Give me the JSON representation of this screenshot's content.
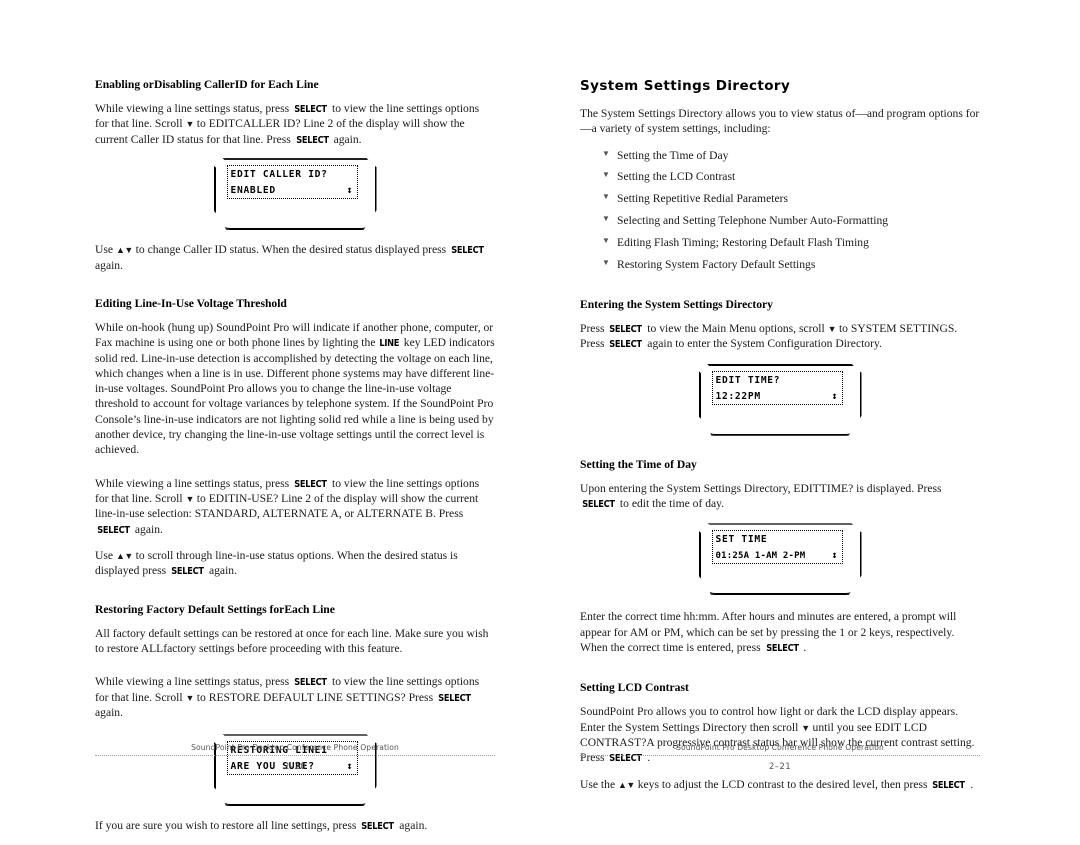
{
  "document": {
    "footer_title": "SoundPoint Pro Desktop Conference Phone Operation"
  },
  "left_page": {
    "page_number": "2–20",
    "sections": [
      {
        "heading": "Enabling orDisabling CallerID for Each Line",
        "para1_a": "While viewing a line settings status, press ",
        "para1_kb1": "SELECT",
        "para1_b": " to view the line settings options for that line. Scroll ",
        "para1_arrow": "▼",
        "para1_c": " to EDITCALLER ID? Line 2 of the display will show the current Caller ID status for that line. Press ",
        "para1_kb2": "SELECT",
        "para1_d": " again.",
        "lcd_line1": "EDIT CALLER ID?",
        "lcd_line2": "ENABLED",
        "lcd_updown": "↕",
        "para2_a": "Use ",
        "para2_arrows": "▲▼",
        "para2_b": " to change Caller ID status. When the desired status displayed press ",
        "para2_kb": "SELECT",
        "para2_c": " again."
      },
      {
        "heading": "Editing Line-In-Use Voltage Threshold",
        "para1_a": "While on-hook (hung up) SoundPoint Pro will indicate if another phone, computer, or Fax machine is using one or both phone lines by lighting the ",
        "para1_kb": "LINE",
        "para1_b": " key LED indicators solid red. Line-in-use detection is accomplished by detecting the voltage on each line, which changes when a line is in use. Different phone systems may have different line-in-use voltages. SoundPoint Pro allows you to change the line-in-use voltage threshold to account for voltage variances by telephone system. If the SoundPoint Pro Console’s line-in-use indicators are not lighting solid red while a line is being used by another device, try changing the line-in-use voltage settings until the correct level is achieved.",
        "para2_a": "While viewing a line settings status, press ",
        "para2_kb1": "SELECT",
        "para2_b": " to view the line settings options for that line. Scroll ",
        "para2_arrow": "▼",
        "para2_c": " to EDITIN-USE? Line 2 of the display will show the current line-in-use selection: STANDARD, ALTERNATE A, or ALTERNATE B. Press ",
        "para2_kb2": "SELECT",
        "para2_d": " again.",
        "para3_a": "Use ",
        "para3_arrows": "▲▼",
        "para3_b": " to scroll through line-in-use status options. When the desired status is displayed press ",
        "para3_kb": "SELECT",
        "para3_c": " again."
      },
      {
        "heading": "Restoring Factory Default Settings forEach Line",
        "para1": "All factory default settings can be restored at once for each line. Make sure you wish to restore ALLfactory settings before proceeding with this feature.",
        "para2_a": "While viewing a line settings status, press ",
        "para2_kb1": "SELECT",
        "para2_b": " to view the line settings options for that line. Scroll ",
        "para2_arrow": "▼",
        "para2_c": " to RESTORE DEFAULT LINE SETTINGS? Press ",
        "para2_kb2": "SELECT",
        "para2_d": " again.",
        "lcd_line1": "RESTORING LINE1",
        "lcd_line2": "ARE YOU SURE?",
        "lcd_updown": "↕",
        "para3_a": "If you are sure you wish to restore all line settings, press ",
        "para3_kb": "SELECT",
        "para3_b": " again."
      }
    ]
  },
  "right_page": {
    "page_number": "2–21",
    "title": "System Settings Directory",
    "intro": "The System Settings Directory allows you to view status of—and program options for—a variety of system settings, including:",
    "bullet_marker": "▼",
    "bullets": [
      "Setting the Time of Day",
      "Setting the LCD Contrast",
      "Setting Repetitive Redial Parameters",
      "Selecting and Setting Telephone Number Auto-Formatting",
      "Editing Flash Timing; Restoring Default Flash Timing",
      "Restoring System Factory Default Settings"
    ],
    "sections": [
      {
        "heading": "Entering the System Settings Directory",
        "para1_a": "Press ",
        "para1_kb1": "SELECT",
        "para1_b": " to view the Main Menu options, scroll ",
        "para1_arrow": "▼",
        "para1_c": " to SYSTEM SETTINGS. Press ",
        "para1_kb2": "SELECT",
        "para1_d": " again to enter the System Configuration Directory.",
        "lcd_line1": "EDIT TIME?",
        "lcd_line2": "12:22PM",
        "lcd_updown": "↕"
      },
      {
        "heading": "Setting the Time of Day",
        "para1_a": "Upon entering the System Settings Directory, EDITTIME? is displayed. Press ",
        "para1_kb": "SELECT",
        "para1_b": " to edit the time of day.",
        "lcd_line1": "SET TIME",
        "lcd_line2": "01:25A 1-AM 2-PM",
        "lcd_updown": "↕",
        "para2_a": "Enter the correct time hh:mm. After hours and minutes are entered, a prompt will appear for AM or PM, which can be set by pressing the 1 or 2 keys, respectively. When the correct time is entered, press ",
        "para2_kb": "SELECT",
        "para2_b": " ."
      },
      {
        "heading": "Setting LCD Contrast",
        "para1_a": "SoundPoint Pro allows you to control how light or dark the LCD display appears. Enter the System Settings Directory then scroll ",
        "para1_arrow": "▼",
        "para1_b": " until you see EDIT LCD CONTRAST?A progressive contrast status bar will show the current contrast setting. Press ",
        "para1_kb": "SELECT",
        "para1_c": " .",
        "para2_a": "Use the ",
        "para2_arrows": "▲▼",
        "para2_b": " keys to adjust the LCD contrast to the desired level, then press ",
        "para2_kb": "SELECT",
        "para2_c": " ."
      }
    ]
  }
}
